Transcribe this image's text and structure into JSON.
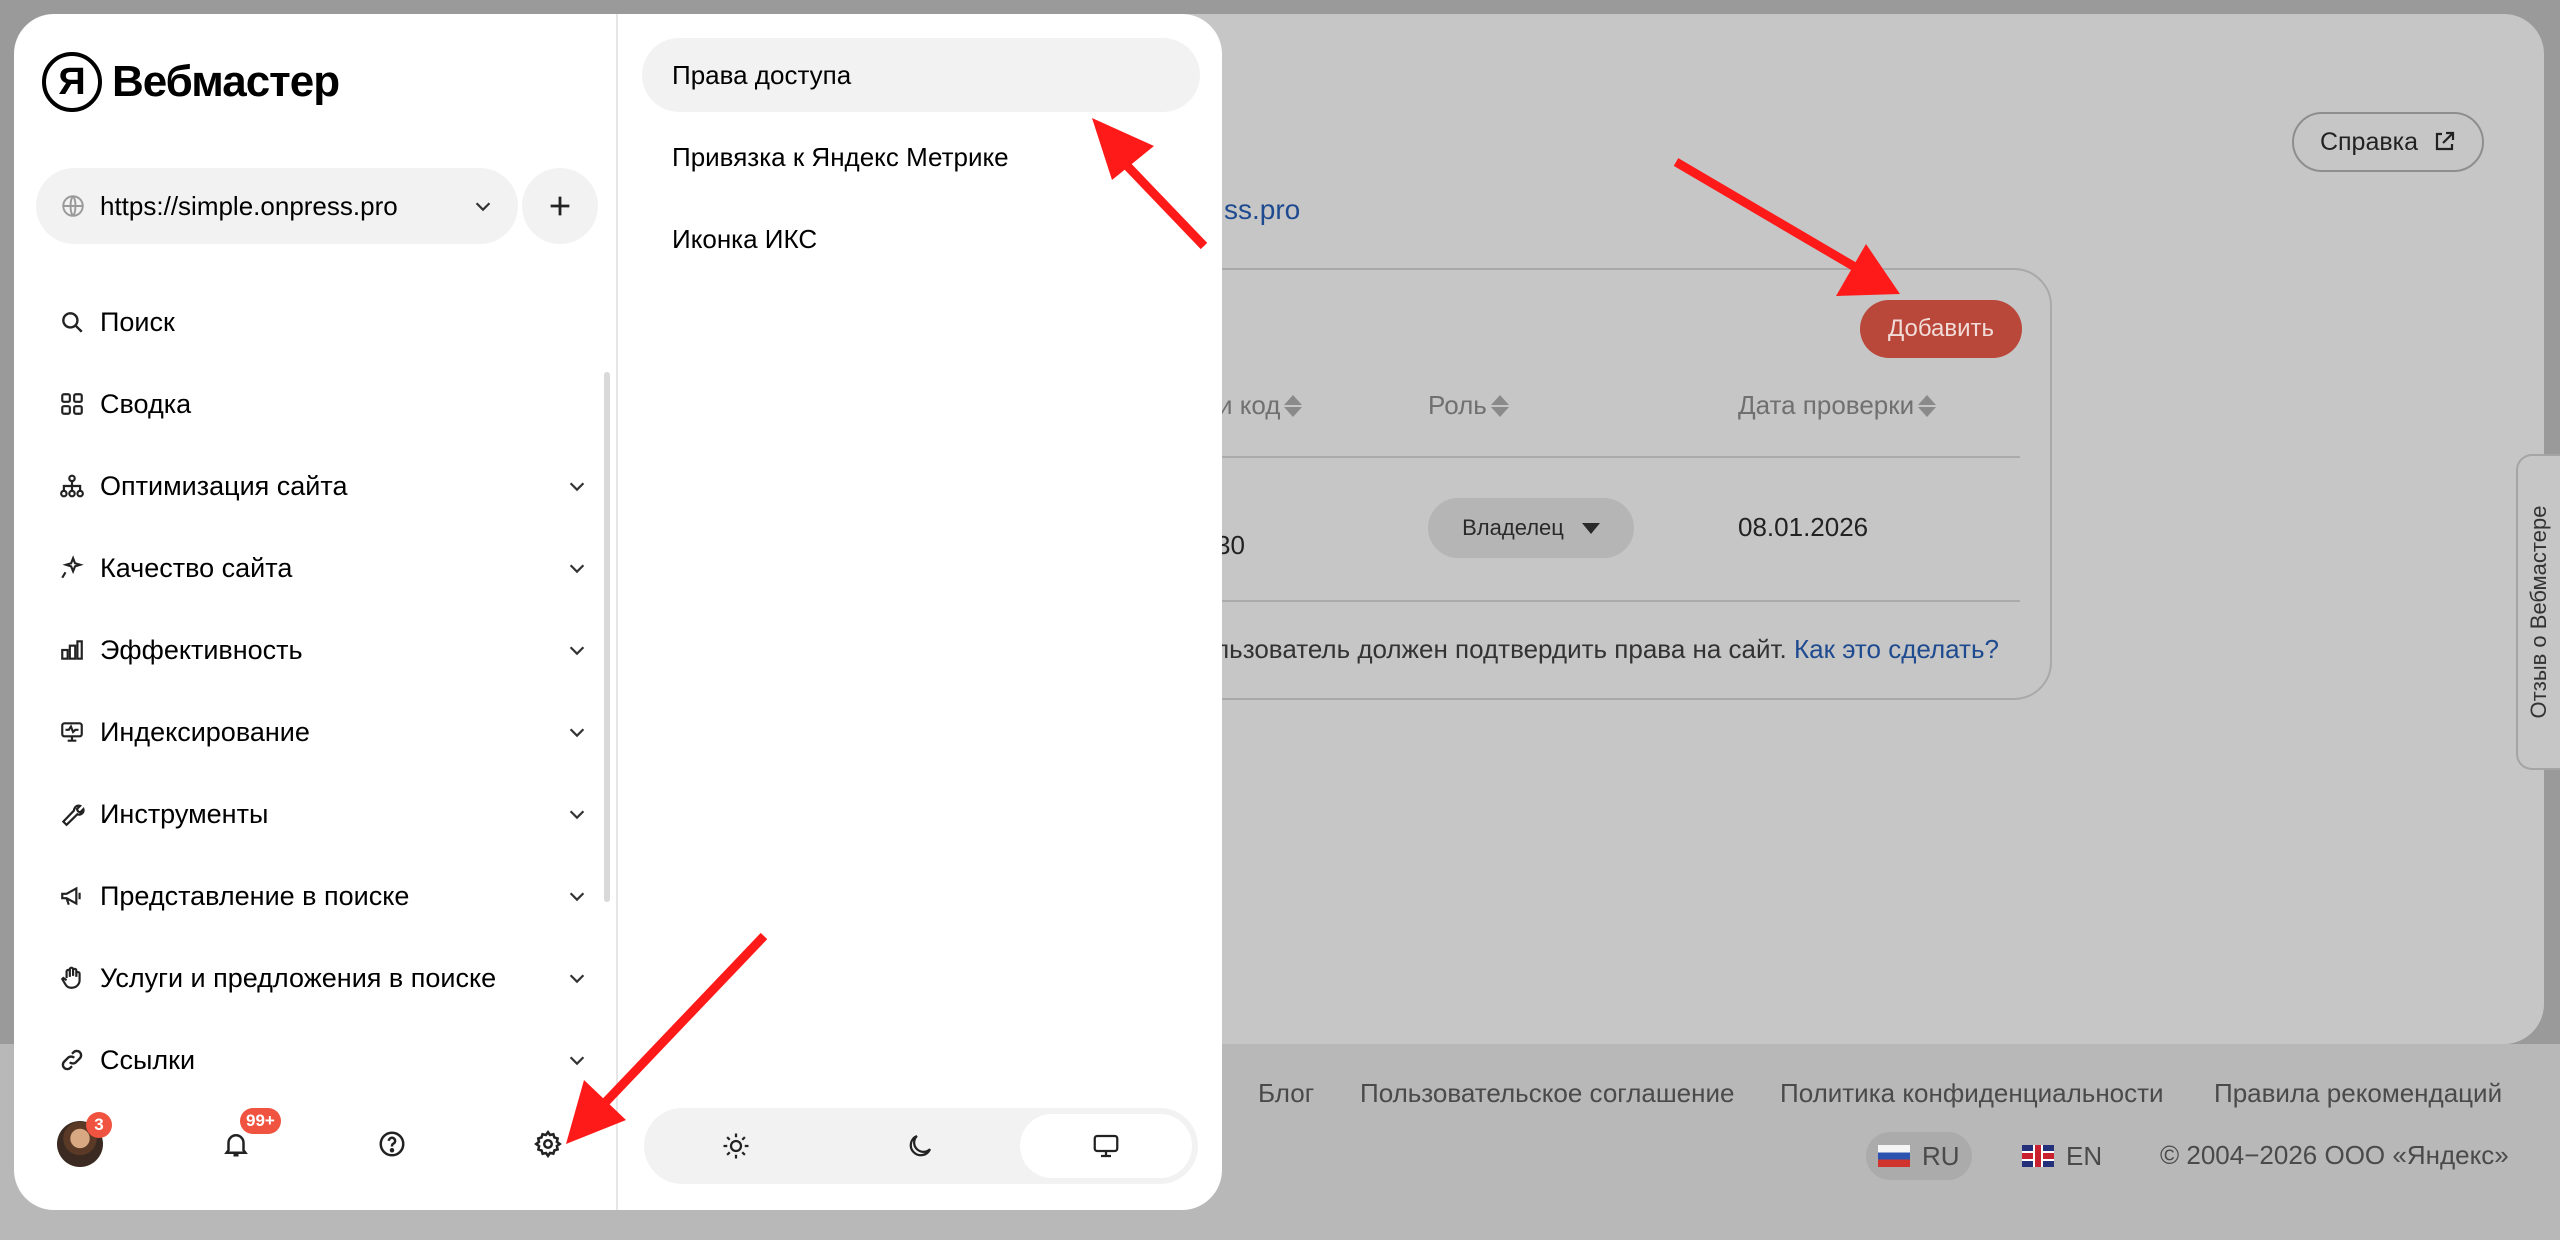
{
  "background": {
    "help_button": "Справка",
    "site_link_fragment": "ss.pro",
    "add_button": "Добавить",
    "columns": [
      {
        "label": "и код"
      },
      {
        "label": "Роль"
      },
      {
        "label": "Дата проверки"
      }
    ],
    "row": {
      "code_fragment": "30",
      "role": "Владелец",
      "date": "08.01.2026"
    },
    "note": "льзователь должен подтвердить права на сайт.",
    "note_link": "Как это сделать?",
    "feedback_tab": "Отзыв о Вебмастере",
    "footer_links": [
      "Блог",
      "Пользовательское соглашение",
      "Политика конфиденциальности",
      "Правила рекомендаций"
    ],
    "lang_ru": "RU",
    "lang_en": "EN",
    "copyright": "© 2004−2026 ООО «Яндекс»"
  },
  "sidebar": {
    "logo_letter": "Я",
    "logo_text": "Вебмастер",
    "site_url": "https://simple.onpress.pro",
    "items": [
      {
        "label": "Поиск",
        "icon": "search-icon"
      },
      {
        "label": "Сводка",
        "icon": "dashboard-icon"
      },
      {
        "label": "Оптимизация сайта",
        "icon": "sitemap-icon"
      },
      {
        "label": "Качество сайта",
        "icon": "sparkle-icon"
      },
      {
        "label": "Эффективность",
        "icon": "bar-chart-icon"
      },
      {
        "label": "Индексирование",
        "icon": "monitor-icon"
      },
      {
        "label": "Инструменты",
        "icon": "wrench-icon"
      },
      {
        "label": "Представление в поиске",
        "icon": "megaphone-icon"
      },
      {
        "label": "Услуги и предложения в поиске",
        "icon": "hand-icon"
      },
      {
        "label": "Ссылки",
        "icon": "link-icon"
      }
    ],
    "avatar_badge": "3",
    "notifications_badge": "99+"
  },
  "submenu": {
    "items": [
      {
        "label": "Права доступа",
        "active": true
      },
      {
        "label": "Привязка к Яндекс Метрике",
        "active": false
      },
      {
        "label": "Иконка ИКС",
        "active": false
      }
    ],
    "theme": {
      "selected": "system"
    }
  },
  "colors": {
    "accent_red": "#f0533f",
    "arrow": "#ff0000",
    "link": "#1e4a8f"
  }
}
